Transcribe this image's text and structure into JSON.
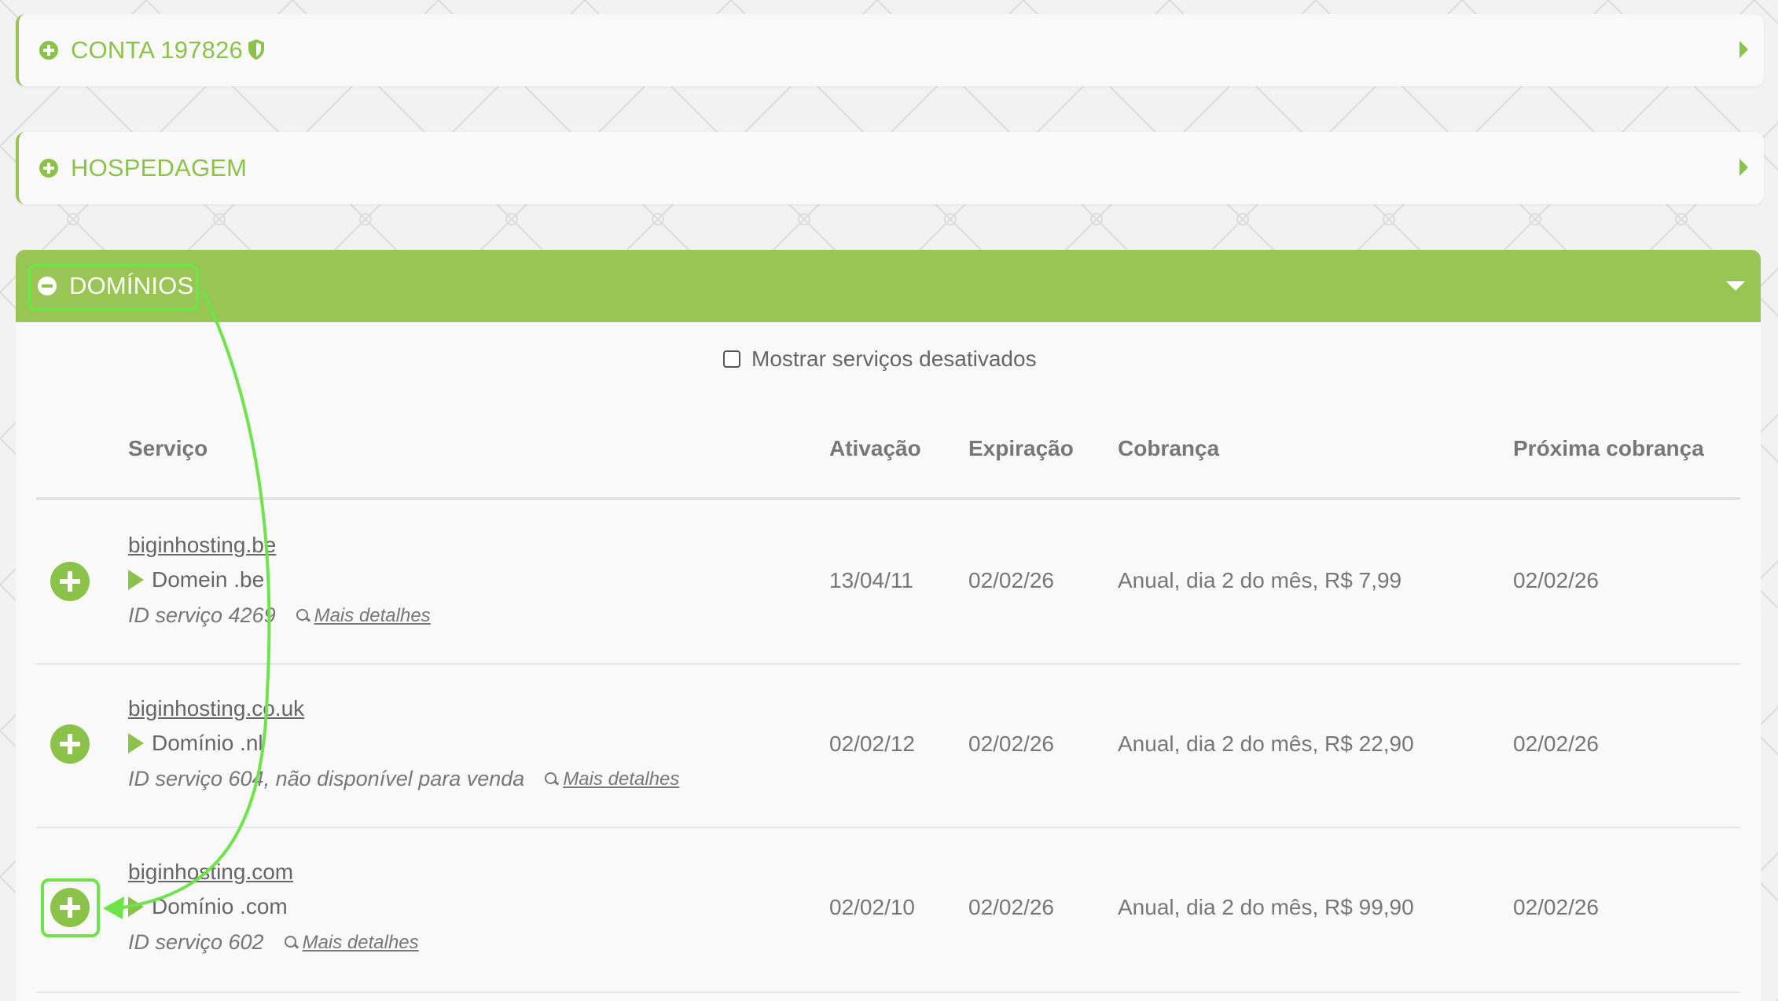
{
  "panels": {
    "conta": {
      "label": "CONTA 197826"
    },
    "hospedagem": {
      "label": "HOSPEDAGEM"
    },
    "dominios": {
      "label": "DOMÍNIOS"
    }
  },
  "filters": {
    "show_disabled_label": "Mostrar serviços desativados",
    "show_disabled_checked": false
  },
  "table": {
    "headers": [
      "Serviço",
      "Ativação",
      "Expiração",
      "Cobrança",
      "Próxima cobrança"
    ],
    "details_label": "Mais detalhes",
    "rows": [
      {
        "domain": "biginhosting.be",
        "product": "Domein .be",
        "service_id": "ID serviço 4269",
        "activation": "13/04/11",
        "expiration": "02/02/26",
        "billing": "Anual, dia 2 do mês, R$ 7,99",
        "next_billing": "02/02/26"
      },
      {
        "domain": "biginhosting.co.uk",
        "product": "Domínio .nl",
        "service_id": "ID serviço 604, não disponível para venda",
        "activation": "02/02/12",
        "expiration": "02/02/26",
        "billing": "Anual, dia 2 do mês, R$ 22,90",
        "next_billing": "02/02/26"
      },
      {
        "domain": "biginhosting.com",
        "product": "Domínio .com",
        "service_id": "ID serviço 602",
        "activation": "02/02/10",
        "expiration": "02/02/26",
        "billing": "Anual, dia 2 do mês, R$ 99,90",
        "next_billing": "02/02/26"
      }
    ]
  },
  "colors": {
    "accent_green": "#8bc34a",
    "header_green": "#99c555",
    "annotation_green": "#6ee34a"
  },
  "icons": [
    "plus-circle-icon",
    "minus-circle-icon",
    "shield-icon",
    "caret-right-icon",
    "caret-down-icon",
    "play-icon",
    "zoom-in-icon",
    "checkbox-icon"
  ]
}
